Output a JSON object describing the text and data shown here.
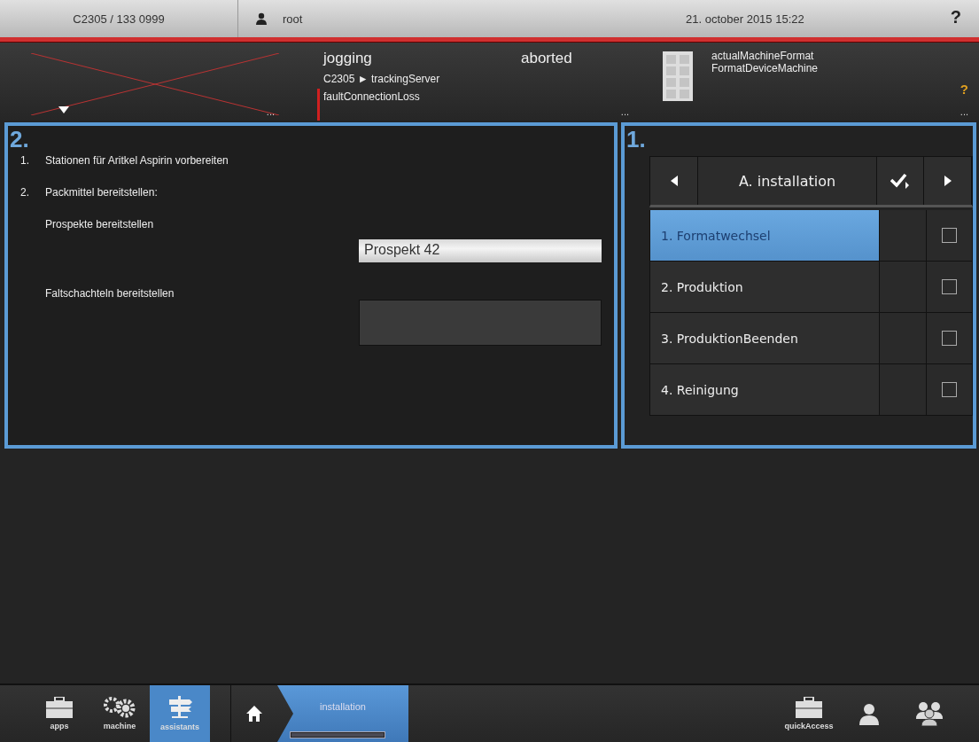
{
  "top_bar": {
    "machine_id": "C2305 / 133 0999",
    "user": "root",
    "datetime": "21. october 2015 15:22",
    "help": "?"
  },
  "status_header": {
    "ellipses": [
      "...",
      "...",
      "..."
    ],
    "mode": "jogging",
    "state": "aborted",
    "path": "C2305 ► trackingServer",
    "fault": "faultConnectionLoss",
    "format": "actualMachineFormat",
    "device": "FormatDeviceMachine",
    "help": "?"
  },
  "instructions_panel": {
    "number": "2.",
    "items": [
      {
        "number": "1.",
        "text": "Stationen für Aritkel Aspirin vorbereiten"
      },
      {
        "number": "2.",
        "text": "Packmittel bereitstellen:"
      }
    ],
    "fields": [
      {
        "label": "Prospekte bereitstellen",
        "value": "Prospekt 42"
      },
      {
        "label": "Faltschachteln bereitstellen"
      }
    ]
  },
  "steps_panel": {
    "number": "1.",
    "title": "A. installation",
    "steps": [
      {
        "label": "1. Formatwechsel",
        "selected": true,
        "checked": false
      },
      {
        "label": "2. Produktion",
        "selected": false,
        "checked": false
      },
      {
        "label": "3. ProduktionBeenden",
        "selected": false,
        "checked": false
      },
      {
        "label": "4. Reinigung",
        "selected": false,
        "checked": false
      }
    ]
  },
  "bottom_bar": {
    "left_tools": [
      {
        "kind": "toolbox",
        "label": "apps",
        "selected": false
      },
      {
        "kind": "gears",
        "label": "machine",
        "selected": false
      },
      {
        "kind": "signpost",
        "label": "assistants",
        "selected": true
      }
    ],
    "breadcrumb": "installation",
    "progress": {
      "level": 1
    },
    "quick_access": "quickAccess"
  }
}
